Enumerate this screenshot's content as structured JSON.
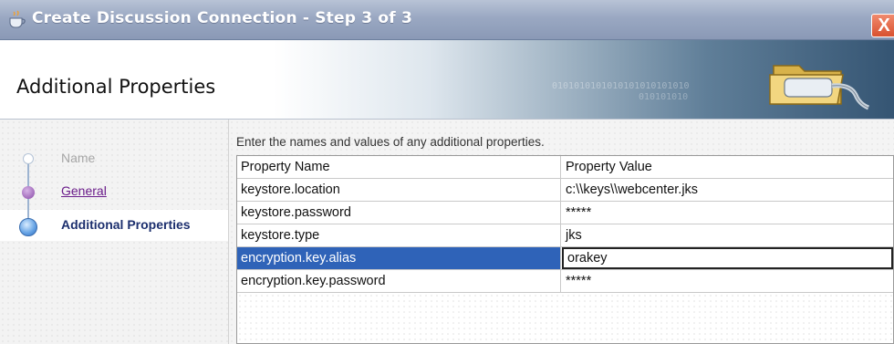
{
  "window": {
    "title": "Create Discussion Connection - Step 3 of 3",
    "close_label": "X"
  },
  "header": {
    "title": "Additional Properties",
    "binary_text_1": "0101010101010101010101010",
    "binary_text_2": "010101010"
  },
  "nav": {
    "steps": [
      {
        "label": "Name",
        "state": "disabled"
      },
      {
        "label": "General",
        "state": "link"
      },
      {
        "label": "Additional Properties",
        "state": "current"
      }
    ]
  },
  "main": {
    "instructions": "Enter the names and values of any additional properties.",
    "columns": [
      "Property Name",
      "Property Value"
    ],
    "rows": [
      {
        "name": "keystore.location",
        "value": "c:\\\\keys\\\\webcenter.jks"
      },
      {
        "name": "keystore.password",
        "value": "*****"
      },
      {
        "name": "keystore.type",
        "value": "jks"
      },
      {
        "name": "encryption.key.alias",
        "value": "orakey",
        "selected": true
      },
      {
        "name": "encryption.key.password",
        "value": "*****"
      }
    ]
  },
  "colors": {
    "selection": "#2f63b8",
    "title_bar": "#9aa8c2",
    "link": "#6a1b8a",
    "current_step": "#1c2f6e"
  },
  "icons": {
    "title": "coffee-cup-icon",
    "header": "folder-plug-icon",
    "close": "close-icon"
  }
}
